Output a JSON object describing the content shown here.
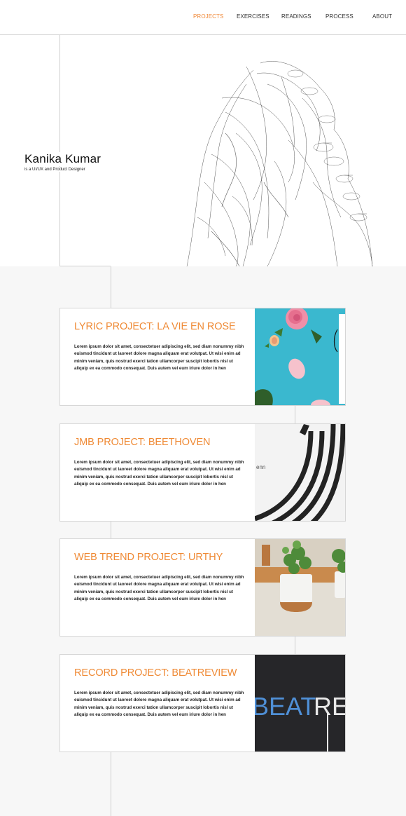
{
  "nav": {
    "items": [
      {
        "label": "PROJECTS",
        "active": true
      },
      {
        "label": "EXERCISES",
        "active": false
      },
      {
        "label": "READINGS",
        "active": false
      },
      {
        "label": "PROCESS",
        "active": false
      },
      {
        "label": "ABOUT",
        "active": false
      }
    ]
  },
  "hero": {
    "name": "Kanika Kumar",
    "subtitle": "is a UI/UX and Product Designer"
  },
  "projects": [
    {
      "title": "LYRIC PROJECT: LA VIE EN ROSE",
      "description": "Lorem ipsum dolor sit amet, consectetuer adipiscing elit, sed diam nonummy nibh euismod tincidunt ut laoreet dolore magna aliquam erat volutpat. Ut wisi enim ad minim veniam, quis nostrud exerci tation ullamcorper suscipit lobortis nisl ut aliquip ex ea commodo consequat. Duis autem vel eum iriure dolor in hen"
    },
    {
      "title": "JMB PROJECT: BEETHOVEN",
      "description": "Lorem ipsum dolor sit amet, consectetuer adipiscing elit, sed diam nonummy nibh euismod tincidunt ut laoreet dolore magna aliquam erat volutpat. Ut wisi enim ad minim veniam, quis nostrud exerci tation ullamcorper suscipit lobortis nisl ut aliquip ex ea commodo consequat. Duis autem vel eum iriure dolor in hen",
      "image_text": "enn"
    },
    {
      "title": "WEB TREND PROJECT: URTHY",
      "description": "Lorem ipsum dolor sit amet, consectetuer adipiscing elit, sed diam nonummy nibh euismod tincidunt ut laoreet dolore magna aliquam erat volutpat. Ut wisi enim ad minim veniam, quis nostrud exerci tation ullamcorper suscipit lobortis nisl ut aliquip ex ea commodo consequat. Duis autem vel eum iriure dolor in hen"
    },
    {
      "title": "RECORD PROJECT: BEATREVIEW",
      "description": "Lorem ipsum dolor sit amet, consectetuer adipiscing elit, sed diam nonummy nibh euismod tincidunt ut laoreet dolore magna aliquam erat volutpat. Ut wisi enim ad minim veniam, quis nostrud exerci tation ullamcorper suscipit lobortis nisl ut aliquip ex ea commodo consequat. Duis autem vel eum iriure dolor in hen",
      "image_text_a": "BEAT",
      "image_text_b": "RE"
    }
  ],
  "colors": {
    "accent": "#f08a3a",
    "border": "#d6d6d6",
    "timeline_bg": "#f7f7f7"
  }
}
